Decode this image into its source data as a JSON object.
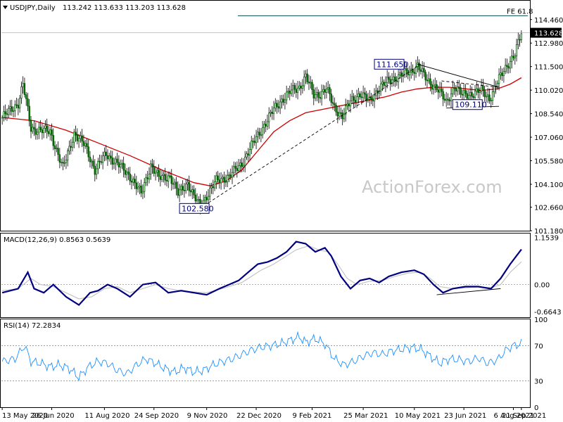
{
  "chart_data": {
    "type": "candlestick",
    "symbol_header": "USDJPY,Daily",
    "ohlc_header": "113.242 113.633 113.203 113.628",
    "last_price": "113.628",
    "watermark": "ActionForex.com",
    "colors": {
      "background": "#ffffff",
      "candle_body": "#006400",
      "candle_wick": "#000000",
      "ma_line": "#cc0000",
      "macd_line": "#000080",
      "signal_line": "#c0c0c0",
      "rsi_line": "#1e90ff",
      "trendline": "#000000",
      "fe_line": "#005050",
      "last_price_label": "#000000"
    },
    "price_pane": {
      "ylim": [
        101.18,
        115.6
      ],
      "y_ticks": [
        "114.460",
        "112.980",
        "111.500",
        "110.020",
        "108.540",
        "107.060",
        "105.580",
        "104.100",
        "102.660",
        "101.180"
      ],
      "annotations": [
        {
          "label": "102.580",
          "value": 102.58
        },
        {
          "label": "111.650",
          "value": 111.65
        },
        {
          "label": "109.110",
          "value": 109.11
        },
        {
          "label": "FE 61.8",
          "value": 114.7
        }
      ],
      "segments": [
        [
          0,
          108.3
        ],
        [
          10,
          109.2
        ],
        [
          13,
          110.4
        ],
        [
          18,
          107.6
        ],
        [
          30,
          107.4
        ],
        [
          38,
          105.1
        ],
        [
          45,
          107.3
        ],
        [
          52,
          106.5
        ],
        [
          58,
          105.0
        ],
        [
          65,
          106.0
        ],
        [
          72,
          105.4
        ],
        [
          80,
          104.6
        ],
        [
          87,
          103.5
        ],
        [
          93,
          105.3
        ],
        [
          98,
          104.5
        ],
        [
          105,
          104.6
        ],
        [
          110,
          103.5
        ],
        [
          116,
          104.2
        ],
        [
          120,
          103.3
        ],
        [
          124,
          102.7
        ],
        [
          128,
          103.4
        ],
        [
          134,
          104.3
        ],
        [
          142,
          104.6
        ],
        [
          150,
          105.4
        ],
        [
          156,
          106.5
        ],
        [
          162,
          107.5
        ],
        [
          170,
          108.8
        ],
        [
          175,
          109.4
        ],
        [
          180,
          109.9
        ],
        [
          186,
          110.2
        ],
        [
          190,
          110.9
        ],
        [
          195,
          109.7
        ],
        [
          199,
          109.8
        ],
        [
          203,
          110.1
        ],
        [
          208,
          108.9
        ],
        [
          213,
          108.4
        ],
        [
          218,
          109.3
        ],
        [
          224,
          109.8
        ],
        [
          230,
          109.3
        ],
        [
          236,
          110.2
        ],
        [
          242,
          110.6
        ],
        [
          250,
          111.0
        ],
        [
          256,
          111.2
        ],
        [
          260,
          111.6
        ],
        [
          266,
          110.6
        ],
        [
          272,
          110.2
        ],
        [
          278,
          109.2
        ],
        [
          283,
          110.3
        ],
        [
          288,
          109.7
        ],
        [
          294,
          109.8
        ],
        [
          300,
          110.0
        ],
        [
          305,
          109.5
        ],
        [
          311,
          110.7
        ],
        [
          316,
          111.6
        ],
        [
          321,
          112.3
        ],
        [
          325,
          113.6
        ]
      ],
      "ma_line": [
        [
          0,
          108.3
        ],
        [
          20,
          108.1
        ],
        [
          40,
          107.5
        ],
        [
          60,
          106.7
        ],
        [
          80,
          105.9
        ],
        [
          100,
          105.0
        ],
        [
          120,
          104.2
        ],
        [
          130,
          104.0
        ],
        [
          140,
          104.3
        ],
        [
          150,
          105.0
        ],
        [
          160,
          106.2
        ],
        [
          170,
          107.4
        ],
        [
          180,
          108.1
        ],
        [
          190,
          108.6
        ],
        [
          200,
          108.8
        ],
        [
          210,
          109.0
        ],
        [
          220,
          109.2
        ],
        [
          230,
          109.4
        ],
        [
          240,
          109.6
        ],
        [
          250,
          109.9
        ],
        [
          260,
          110.1
        ],
        [
          270,
          110.2
        ],
        [
          280,
          110.2
        ],
        [
          290,
          110.1
        ],
        [
          300,
          110.0
        ],
        [
          310,
          110.1
        ],
        [
          318,
          110.4
        ],
        [
          325,
          110.8
        ]
      ],
      "trendlines": [
        {
          "from": [
            124,
            102.6
          ],
          "to": [
            262,
            111.65
          ],
          "dashed": true
        },
        {
          "from": [
            260,
            111.65
          ],
          "to": [
            311,
            110.2
          ],
          "dashed": false
        },
        {
          "from": [
            278,
            108.9
          ],
          "to": [
            311,
            109.0
          ],
          "dashed": false
        },
        {
          "from": [
            275,
            110.6
          ],
          "to": [
            311,
            110.2
          ],
          "dashed": true
        }
      ]
    },
    "macd_pane": {
      "title": "MACD(12,26,9) 0.8563 0.5639",
      "ylim": [
        -0.8,
        1.25
      ],
      "y_ticks": [
        "1.1539",
        "0.00",
        "-0.6643"
      ],
      "macd": [
        [
          0,
          -0.2
        ],
        [
          10,
          -0.1
        ],
        [
          16,
          0.3
        ],
        [
          20,
          -0.1
        ],
        [
          26,
          -0.2
        ],
        [
          32,
          0.0
        ],
        [
          40,
          -0.3
        ],
        [
          48,
          -0.5
        ],
        [
          55,
          -0.2
        ],
        [
          60,
          -0.15
        ],
        [
          66,
          0.0
        ],
        [
          72,
          -0.1
        ],
        [
          80,
          -0.3
        ],
        [
          88,
          0.0
        ],
        [
          96,
          0.05
        ],
        [
          104,
          -0.2
        ],
        [
          112,
          -0.15
        ],
        [
          120,
          -0.2
        ],
        [
          128,
          -0.25
        ],
        [
          136,
          -0.1
        ],
        [
          142,
          0.0
        ],
        [
          148,
          0.1
        ],
        [
          154,
          0.3
        ],
        [
          160,
          0.5
        ],
        [
          166,
          0.55
        ],
        [
          172,
          0.65
        ],
        [
          178,
          0.8
        ],
        [
          184,
          1.05
        ],
        [
          190,
          1.0
        ],
        [
          196,
          0.8
        ],
        [
          202,
          0.9
        ],
        [
          206,
          0.7
        ],
        [
          212,
          0.2
        ],
        [
          218,
          -0.1
        ],
        [
          224,
          0.1
        ],
        [
          230,
          0.15
        ],
        [
          236,
          0.05
        ],
        [
          242,
          0.2
        ],
        [
          250,
          0.3
        ],
        [
          258,
          0.35
        ],
        [
          264,
          0.25
        ],
        [
          270,
          0.0
        ],
        [
          276,
          -0.2
        ],
        [
          282,
          -0.1
        ],
        [
          290,
          -0.05
        ],
        [
          298,
          -0.05
        ],
        [
          306,
          -0.1
        ],
        [
          312,
          0.15
        ],
        [
          318,
          0.5
        ],
        [
          325,
          0.86
        ]
      ],
      "signal": [
        [
          0,
          -0.15
        ],
        [
          10,
          -0.1
        ],
        [
          18,
          0.15
        ],
        [
          24,
          0.0
        ],
        [
          32,
          -0.05
        ],
        [
          40,
          -0.2
        ],
        [
          48,
          -0.35
        ],
        [
          56,
          -0.3
        ],
        [
          64,
          -0.1
        ],
        [
          72,
          -0.05
        ],
        [
          80,
          -0.2
        ],
        [
          88,
          -0.1
        ],
        [
          96,
          0.0
        ],
        [
          104,
          -0.1
        ],
        [
          112,
          -0.15
        ],
        [
          120,
          -0.18
        ],
        [
          128,
          -0.2
        ],
        [
          136,
          -0.12
        ],
        [
          142,
          -0.05
        ],
        [
          150,
          0.05
        ],
        [
          156,
          0.2
        ],
        [
          162,
          0.35
        ],
        [
          170,
          0.5
        ],
        [
          176,
          0.65
        ],
        [
          184,
          0.85
        ],
        [
          192,
          0.95
        ],
        [
          198,
          0.85
        ],
        [
          204,
          0.8
        ],
        [
          210,
          0.5
        ],
        [
          216,
          0.15
        ],
        [
          222,
          0.0
        ],
        [
          230,
          0.08
        ],
        [
          238,
          0.1
        ],
        [
          246,
          0.2
        ],
        [
          254,
          0.28
        ],
        [
          262,
          0.3
        ],
        [
          268,
          0.15
        ],
        [
          274,
          -0.05
        ],
        [
          282,
          -0.1
        ],
        [
          290,
          -0.08
        ],
        [
          298,
          -0.06
        ],
        [
          306,
          -0.08
        ],
        [
          312,
          0.0
        ],
        [
          318,
          0.3
        ],
        [
          325,
          0.56
        ]
      ],
      "divergence_line": {
        "from": [
          272,
          -0.25
        ],
        "to": [
          312,
          -0.1
        ]
      }
    },
    "rsi_pane": {
      "title": "RSI(14) 72.2834",
      "ylim": [
        0,
        100
      ],
      "y_ticks": [
        "100",
        "70",
        "30",
        "0"
      ],
      "levels": [
        70,
        30
      ],
      "rsi": [
        [
          0,
          52
        ],
        [
          8,
          55
        ],
        [
          14,
          70
        ],
        [
          18,
          52
        ],
        [
          24,
          50
        ],
        [
          30,
          46
        ],
        [
          36,
          48
        ],
        [
          42,
          44
        ],
        [
          48,
          34
        ],
        [
          54,
          46
        ],
        [
          60,
          52
        ],
        [
          66,
          50
        ],
        [
          72,
          42
        ],
        [
          78,
          38
        ],
        [
          84,
          48
        ],
        [
          90,
          55
        ],
        [
          96,
          50
        ],
        [
          102,
          44
        ],
        [
          108,
          40
        ],
        [
          114,
          45
        ],
        [
          120,
          40
        ],
        [
          126,
          42
        ],
        [
          132,
          48
        ],
        [
          138,
          52
        ],
        [
          144,
          55
        ],
        [
          150,
          60
        ],
        [
          156,
          65
        ],
        [
          162,
          68
        ],
        [
          168,
          70
        ],
        [
          174,
          72
        ],
        [
          180,
          76
        ],
        [
          186,
          80
        ],
        [
          190,
          74
        ],
        [
          196,
          78
        ],
        [
          202,
          72
        ],
        [
          208,
          55
        ],
        [
          214,
          48
        ],
        [
          220,
          52
        ],
        [
          226,
          58
        ],
        [
          232,
          62
        ],
        [
          238,
          60
        ],
        [
          244,
          64
        ],
        [
          250,
          66
        ],
        [
          256,
          68
        ],
        [
          262,
          66
        ],
        [
          268,
          58
        ],
        [
          274,
          50
        ],
        [
          280,
          55
        ],
        [
          286,
          54
        ],
        [
          292,
          52
        ],
        [
          298,
          56
        ],
        [
          304,
          50
        ],
        [
          310,
          54
        ],
        [
          316,
          66
        ],
        [
          320,
          70
        ],
        [
          325,
          72
        ]
      ]
    },
    "x_axis": {
      "total_bars": 326,
      "ticks": [
        {
          "label": "13 May 2020",
          "bar": 0
        },
        {
          "label": "26 Jun 2020",
          "bar": 31
        },
        {
          "label": "11 Aug 2020",
          "bar": 64
        },
        {
          "label": "24 Sep 2020",
          "bar": 95
        },
        {
          "label": "9 Nov 2020",
          "bar": 128
        },
        {
          "label": "22 Dec 2020",
          "bar": 159
        },
        {
          "label": "9 Feb 2021",
          "bar": 194
        },
        {
          "label": "25 Mar 2021",
          "bar": 226
        },
        {
          "label": "10 May 2021",
          "bar": 258
        },
        {
          "label": "23 Jun 2021",
          "bar": 289
        },
        {
          "label": "6 Aug 2021",
          "bar": 320
        },
        {
          "label": "21 Sep 2021",
          "bar": 351
        }
      ]
    }
  }
}
